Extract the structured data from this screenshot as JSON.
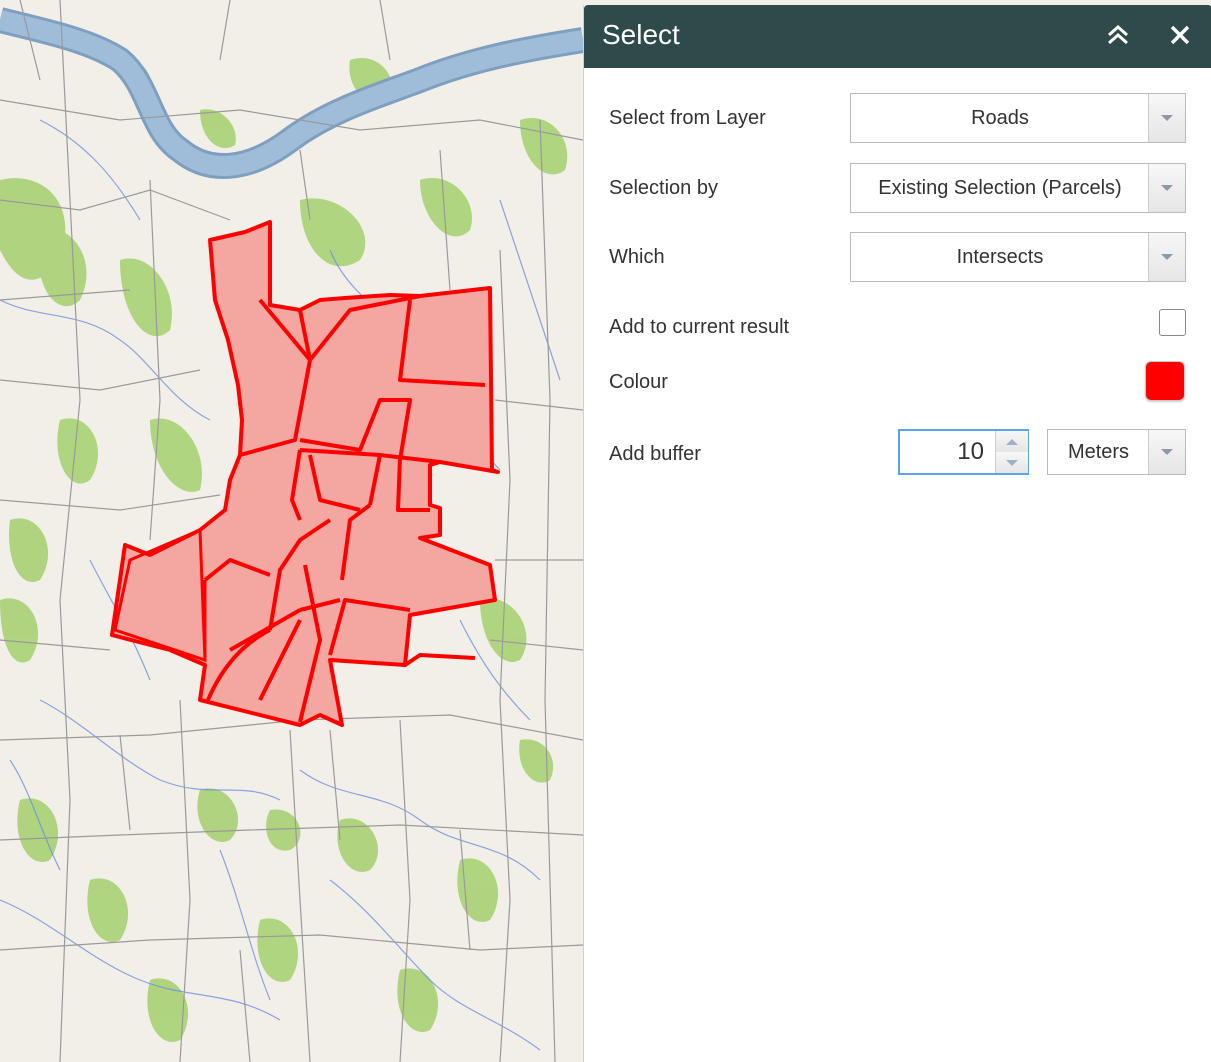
{
  "panel": {
    "title": "Select",
    "collapse_icon": "double-chevron-up-icon",
    "close_icon": "close-icon"
  },
  "form": {
    "select_from_layer": {
      "label": "Select from Layer",
      "value": "Roads"
    },
    "selection_by": {
      "label": "Selection by",
      "value": "Existing Selection (Parcels)"
    },
    "which": {
      "label": "Which",
      "value": "Intersects"
    },
    "add_to_current": {
      "label": "Add to current result",
      "checked": false
    },
    "colour": {
      "label": "Colour",
      "value": "#ff0000"
    },
    "add_buffer": {
      "label": "Add buffer",
      "value": "10",
      "unit": "Meters"
    }
  },
  "colors": {
    "header_bg": "#2f4a4a",
    "selection_fill": "#f4a6a0",
    "selection_stroke": "#ff0000",
    "river": "#9fbcd8",
    "vegetation": "#a8d174"
  }
}
